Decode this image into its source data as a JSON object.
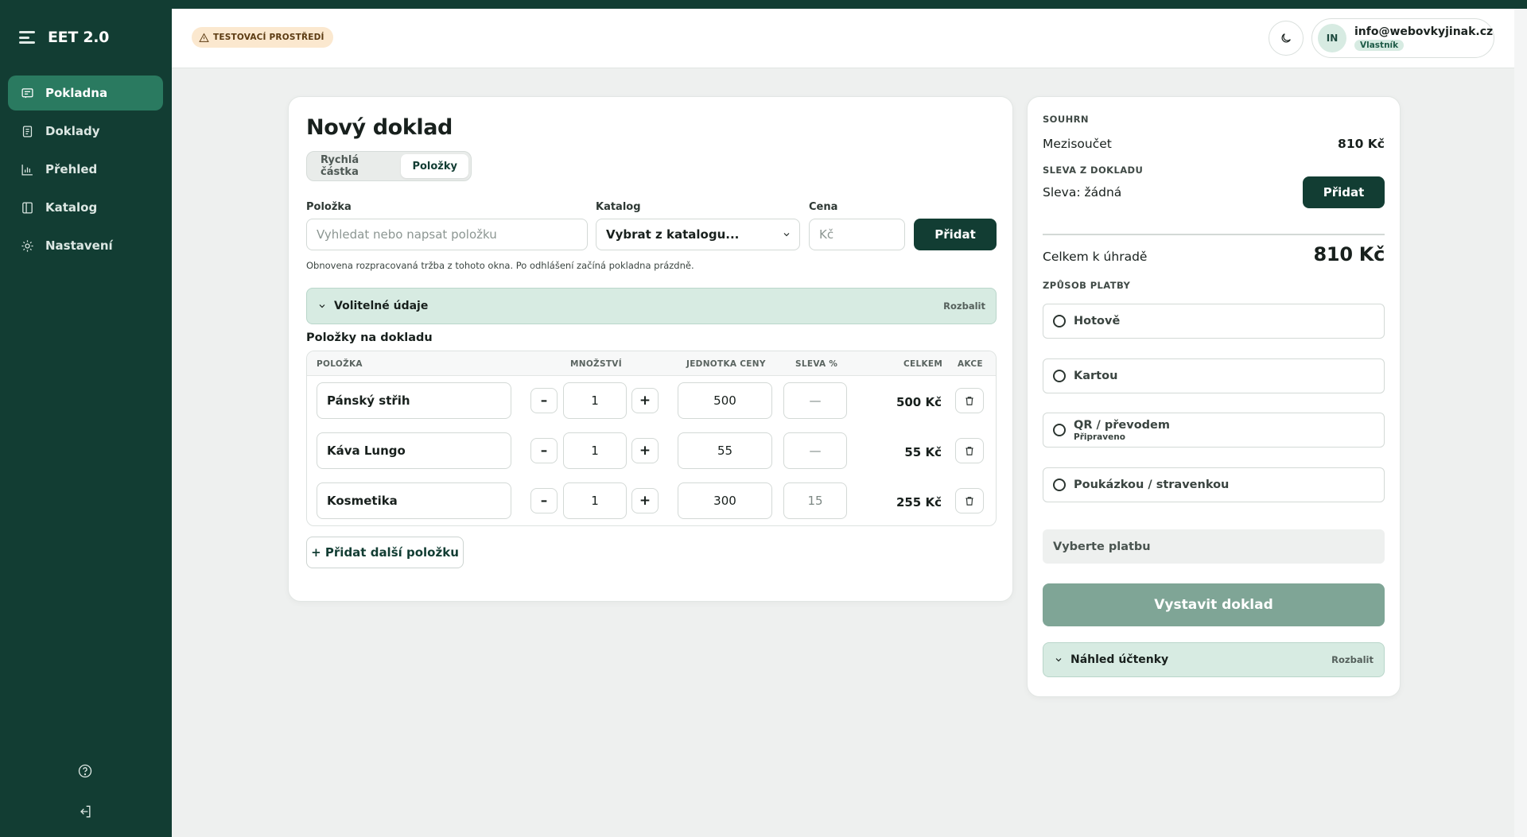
{
  "app": {
    "name": "EET 2.0"
  },
  "sidebar": {
    "items": [
      {
        "label": "Pokladna",
        "icon": "receipt-icon",
        "active": true
      },
      {
        "label": "Doklady",
        "icon": "document-icon",
        "active": false
      },
      {
        "label": "Přehled",
        "icon": "chart-icon",
        "active": false
      },
      {
        "label": "Katalog",
        "icon": "book-icon",
        "active": false
      },
      {
        "label": "Nastavení",
        "icon": "gear-icon",
        "active": false
      }
    ],
    "bottom_icons": [
      "help-icon",
      "logout-icon"
    ]
  },
  "header": {
    "environment_badge": "TESTOVACÍ PROSTŘEDÍ",
    "user": {
      "initials": "IN",
      "email": "info@webovkyjinak.cz",
      "role": "Vlastník"
    }
  },
  "main": {
    "title": "Nový doklad",
    "tabs": [
      {
        "label": "Rychlá částka",
        "active": false
      },
      {
        "label": "Položky",
        "active": true
      }
    ],
    "form": {
      "item_label": "Položka",
      "item_placeholder": "Vyhledat nebo napsat položku",
      "catalog_label": "Katalog",
      "catalog_value": "Vybrat z katalogu...",
      "price_label": "Cena",
      "price_placeholder": "Kč",
      "add_label": "Přidat"
    },
    "note": "Obnovena rozpracovaná tržba z tohoto okna. Po odhlášení začíná pokladna prázdně.",
    "optional": {
      "label": "Volitelné údaje",
      "action": "Rozbalit"
    },
    "items_title": "Položky na dokladu",
    "table": {
      "headers": [
        "POLOŽKA",
        "MNOŽSTVÍ",
        "JEDNOTKA CENY",
        "SLEVA %",
        "CELKEM",
        "AKCE"
      ],
      "rows": [
        {
          "name": "Pánský střih",
          "qty": "1",
          "price": "500",
          "discount": "—",
          "total": "500 Kč"
        },
        {
          "name": "Káva Lungo",
          "qty": "1",
          "price": "55",
          "discount": "—",
          "total": "55 Kč"
        },
        {
          "name": "Kosmetika",
          "qty": "1",
          "price": "300",
          "discount": "15",
          "total": "255 Kč"
        }
      ],
      "minus": "–",
      "plus": "+"
    },
    "add_more_label": "+ Přidat další položku"
  },
  "summary": {
    "section_label": "SOUHRN",
    "subtotal_label": "Mezisoučet",
    "subtotal_value": "810 Kč",
    "discount_section": "SLEVA Z DOKLADU",
    "discount_label": "Sleva: žádná",
    "discount_add": "Přidat",
    "total_label": "Celkem k úhradě",
    "total_value": "810 Kč",
    "payment_section": "ZPŮSOB PLATBY",
    "payment_options": [
      {
        "label": "Hotově",
        "sub": ""
      },
      {
        "label": "Kartou",
        "sub": ""
      },
      {
        "label": "QR / převodem",
        "sub": "Připraveno"
      },
      {
        "label": "Poukázkou / stravenkou",
        "sub": ""
      }
    ],
    "payment_hint": "Vyberte platbu",
    "submit_label": "Vystavit doklad",
    "preview": {
      "label": "Náhled účtenky",
      "action": "Rozbalit"
    }
  },
  "colors": {
    "sidebar": "#123d33",
    "accent": "#2a7a60",
    "primary_button": "#123d33",
    "disabled_button": "#7fa596",
    "soft_green": "#d7ebe2",
    "warning_badge": "#fbe8cf"
  }
}
